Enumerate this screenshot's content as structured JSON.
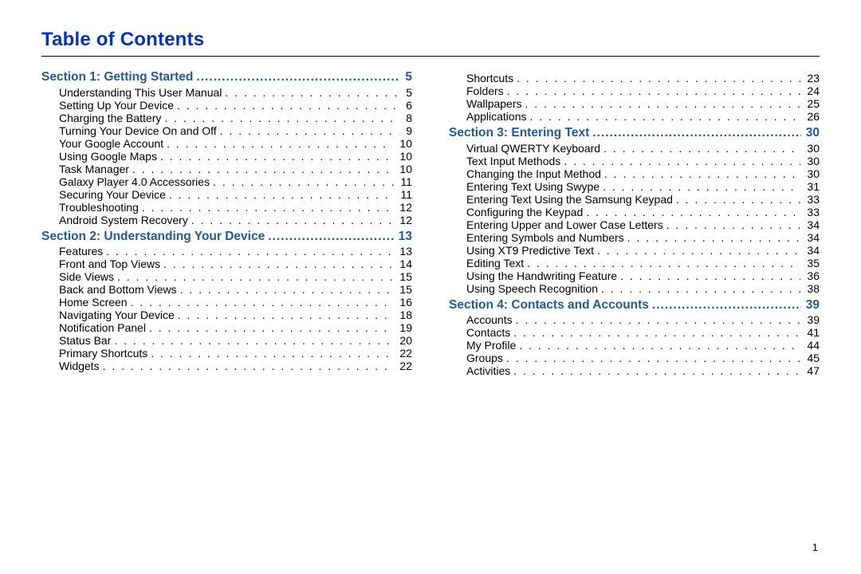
{
  "title": "Table of Contents",
  "page_number": "1",
  "columns": [
    {
      "entries": [
        {
          "type": "section",
          "label": "Section 1:  Getting Started",
          "page": "5"
        },
        {
          "type": "sub",
          "label": "Understanding This User Manual",
          "page": "5"
        },
        {
          "type": "sub",
          "label": "Setting Up Your Device",
          "page": "6"
        },
        {
          "type": "sub",
          "label": "Charging the Battery",
          "page": "8"
        },
        {
          "type": "sub",
          "label": "Turning Your Device On and Off",
          "page": "9"
        },
        {
          "type": "sub",
          "label": "Your Google Account",
          "page": "10"
        },
        {
          "type": "sub",
          "label": "Using Google Maps",
          "page": "10"
        },
        {
          "type": "sub",
          "label": "Task Manager",
          "page": "10"
        },
        {
          "type": "sub",
          "label": "Galaxy Player 4.0 Accessories",
          "page": "11"
        },
        {
          "type": "sub",
          "label": "Securing Your Device",
          "page": "11"
        },
        {
          "type": "sub",
          "label": "Troubleshooting",
          "page": "12"
        },
        {
          "type": "sub",
          "label": "Android System Recovery",
          "page": "12"
        },
        {
          "type": "section",
          "label": "Section 2:  Understanding Your Device",
          "page": "13"
        },
        {
          "type": "sub",
          "label": "Features",
          "page": "13"
        },
        {
          "type": "sub",
          "label": "Front and Top Views",
          "page": "14"
        },
        {
          "type": "sub",
          "label": "Side Views",
          "page": "15"
        },
        {
          "type": "sub",
          "label": "Back and Bottom Views",
          "page": "15"
        },
        {
          "type": "sub",
          "label": "Home Screen",
          "page": "16"
        },
        {
          "type": "sub",
          "label": "Navigating Your Device",
          "page": "18"
        },
        {
          "type": "sub",
          "label": "Notification Panel",
          "page": "19"
        },
        {
          "type": "sub",
          "label": "Status Bar",
          "page": "20"
        },
        {
          "type": "sub",
          "label": "Primary Shortcuts",
          "page": "22"
        },
        {
          "type": "sub",
          "label": "Widgets",
          "page": "22"
        }
      ]
    },
    {
      "entries": [
        {
          "type": "sub",
          "label": "Shortcuts",
          "page": "23"
        },
        {
          "type": "sub",
          "label": "Folders",
          "page": "24"
        },
        {
          "type": "sub",
          "label": "Wallpapers",
          "page": "25"
        },
        {
          "type": "sub",
          "label": "Applications",
          "page": "26"
        },
        {
          "type": "section",
          "label": "Section 3:  Entering Text",
          "page": "30"
        },
        {
          "type": "sub",
          "label": "Virtual QWERTY Keyboard",
          "page": "30"
        },
        {
          "type": "sub",
          "label": "Text Input Methods",
          "page": "30"
        },
        {
          "type": "sub",
          "label": "Changing the Input Method",
          "page": "30"
        },
        {
          "type": "sub",
          "label": "Entering Text Using Swype",
          "page": "31"
        },
        {
          "type": "sub",
          "label": "Entering Text Using the Samsung Keypad",
          "page": "33"
        },
        {
          "type": "sub",
          "label": "Configuring the Keypad",
          "page": "33"
        },
        {
          "type": "sub",
          "label": "Entering Upper and Lower Case Letters",
          "page": "34"
        },
        {
          "type": "sub",
          "label": "Entering Symbols and Numbers",
          "page": "34"
        },
        {
          "type": "sub",
          "label": "Using XT9 Predictive Text",
          "page": "34"
        },
        {
          "type": "sub",
          "label": "Editing Text",
          "page": "35"
        },
        {
          "type": "sub",
          "label": "Using the Handwriting Feature",
          "page": "36"
        },
        {
          "type": "sub",
          "label": "Using Speech Recognition",
          "page": "38"
        },
        {
          "type": "section",
          "label": "Section 4:  Contacts and Accounts",
          "page": "39"
        },
        {
          "type": "sub",
          "label": "Accounts",
          "page": "39"
        },
        {
          "type": "sub",
          "label": "Contacts",
          "page": "41"
        },
        {
          "type": "sub",
          "label": "My Profile",
          "page": "44"
        },
        {
          "type": "sub",
          "label": "Groups",
          "page": "45"
        },
        {
          "type": "sub",
          "label": "Activities",
          "page": "47"
        }
      ]
    }
  ]
}
